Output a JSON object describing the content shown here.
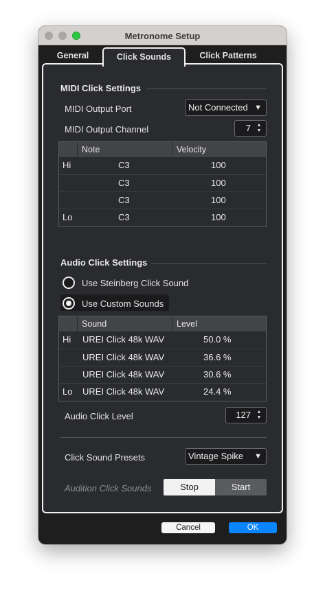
{
  "window": {
    "title": "Metronome Setup"
  },
  "tabs": [
    {
      "label": "General"
    },
    {
      "label": "Click Sounds",
      "active": true
    },
    {
      "label": "Click Patterns"
    }
  ],
  "midi": {
    "section_title": "MIDI Click Settings",
    "output_port_label": "MIDI Output Port",
    "output_port_value": "Not Connected",
    "output_channel_label": "MIDI Output Channel",
    "output_channel_value": "7",
    "table": {
      "headers": [
        "",
        "Note",
        "Velocity"
      ],
      "rows": [
        {
          "tag": "Hi",
          "note": "C3",
          "velocity": "100"
        },
        {
          "tag": "",
          "note": "C3",
          "velocity": "100"
        },
        {
          "tag": "",
          "note": "C3",
          "velocity": "100"
        },
        {
          "tag": "Lo",
          "note": "C3",
          "velocity": "100"
        }
      ]
    }
  },
  "audio": {
    "section_title": "Audio Click Settings",
    "radio_steinberg": "Use Steinberg Click Sound",
    "radio_custom": "Use Custom Sounds",
    "selected": "custom",
    "table": {
      "headers": [
        "",
        "Sound",
        "Level"
      ],
      "rows": [
        {
          "tag": "Hi",
          "sound": "UREI Click 48k WAV",
          "level": "50.0 %"
        },
        {
          "tag": "",
          "sound": "UREI Click 48k WAV",
          "level": "36.6 %"
        },
        {
          "tag": "",
          "sound": "UREI Click 48k WAV",
          "level": "30.6 %"
        },
        {
          "tag": "Lo",
          "sound": "UREI Click 48k WAV",
          "level": "24.4 %"
        }
      ]
    },
    "click_level_label": "Audio Click Level",
    "click_level_value": "127",
    "presets_label": "Click Sound Presets",
    "presets_value": "Vintage Spike",
    "audition_label": "Audition Click Sounds",
    "stop_label": "Stop",
    "start_label": "Start"
  },
  "footer": {
    "cancel_label": "Cancel",
    "ok_label": "OK"
  },
  "colors": {
    "accent": "#0a84ff",
    "background": "#2a2b2e",
    "titlebar": "#d4d0cd"
  },
  "icons": {
    "dropdown": "▼",
    "spin_up": "▲",
    "spin_down": "▼"
  }
}
